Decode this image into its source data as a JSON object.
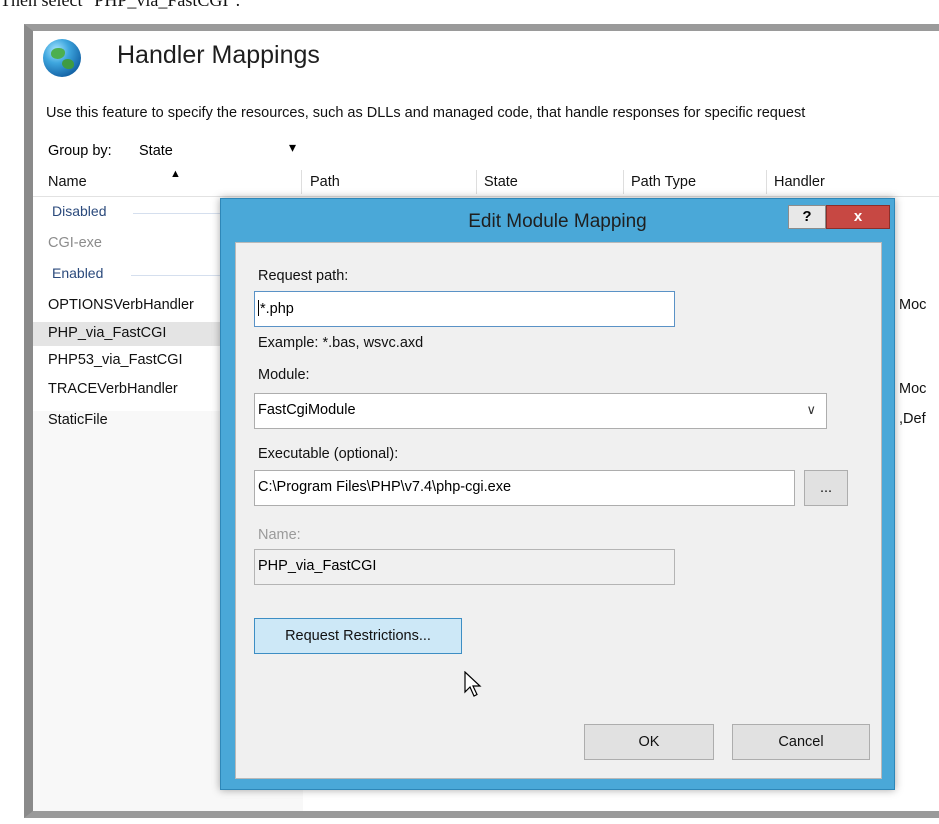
{
  "caption": "Then select \"PHP_via_FastCGI\".",
  "page": {
    "title": "Handler Mappings",
    "icon": "globe-icon",
    "description": "Use this feature to specify the resources, such as DLLs and managed code, that handle responses for specific request",
    "group_by_label": "Group by:",
    "group_by_value": "State",
    "columns": [
      "Name",
      "Path",
      "State",
      "Path Type",
      "Handler"
    ],
    "groups": {
      "disabled": "Disabled",
      "enabled": "Enabled"
    },
    "rows": [
      {
        "name": "CGI-exe",
        "state": "disabled",
        "handler_fragment": ""
      },
      {
        "name": "OPTIONSVerbHandler",
        "state": "enabled",
        "handler_fragment": "Moc"
      },
      {
        "name": "PHP_via_FastCGI",
        "state": "enabled",
        "handler_fragment": ""
      },
      {
        "name": "PHP53_via_FastCGI",
        "state": "enabled",
        "handler_fragment": ""
      },
      {
        "name": "TRACEVerbHandler",
        "state": "enabled",
        "handler_fragment": "Moc"
      },
      {
        "name": "StaticFile",
        "state": "enabled",
        "handler_fragment": ",Def"
      }
    ]
  },
  "dialog": {
    "title": "Edit Module Mapping",
    "help_label": "?",
    "close_label": "x",
    "request_path_label": "Request path:",
    "request_path_value": "*.php",
    "example_text": "Example: *.bas, wsvc.axd",
    "module_label": "Module:",
    "module_value": "FastCgiModule",
    "executable_label": "Executable (optional):",
    "executable_value": "C:\\Program Files\\PHP\\v7.4\\php-cgi.exe",
    "browse_label": "...",
    "name_label": "Name:",
    "name_value": "PHP_via_FastCGI",
    "restrictions_label": "Request Restrictions...",
    "ok_label": "OK",
    "cancel_label": "Cancel"
  },
  "colors": {
    "dialog_frame": "#4aa8d8",
    "close_button": "#c74843",
    "group_header": "#2b4a7c"
  }
}
